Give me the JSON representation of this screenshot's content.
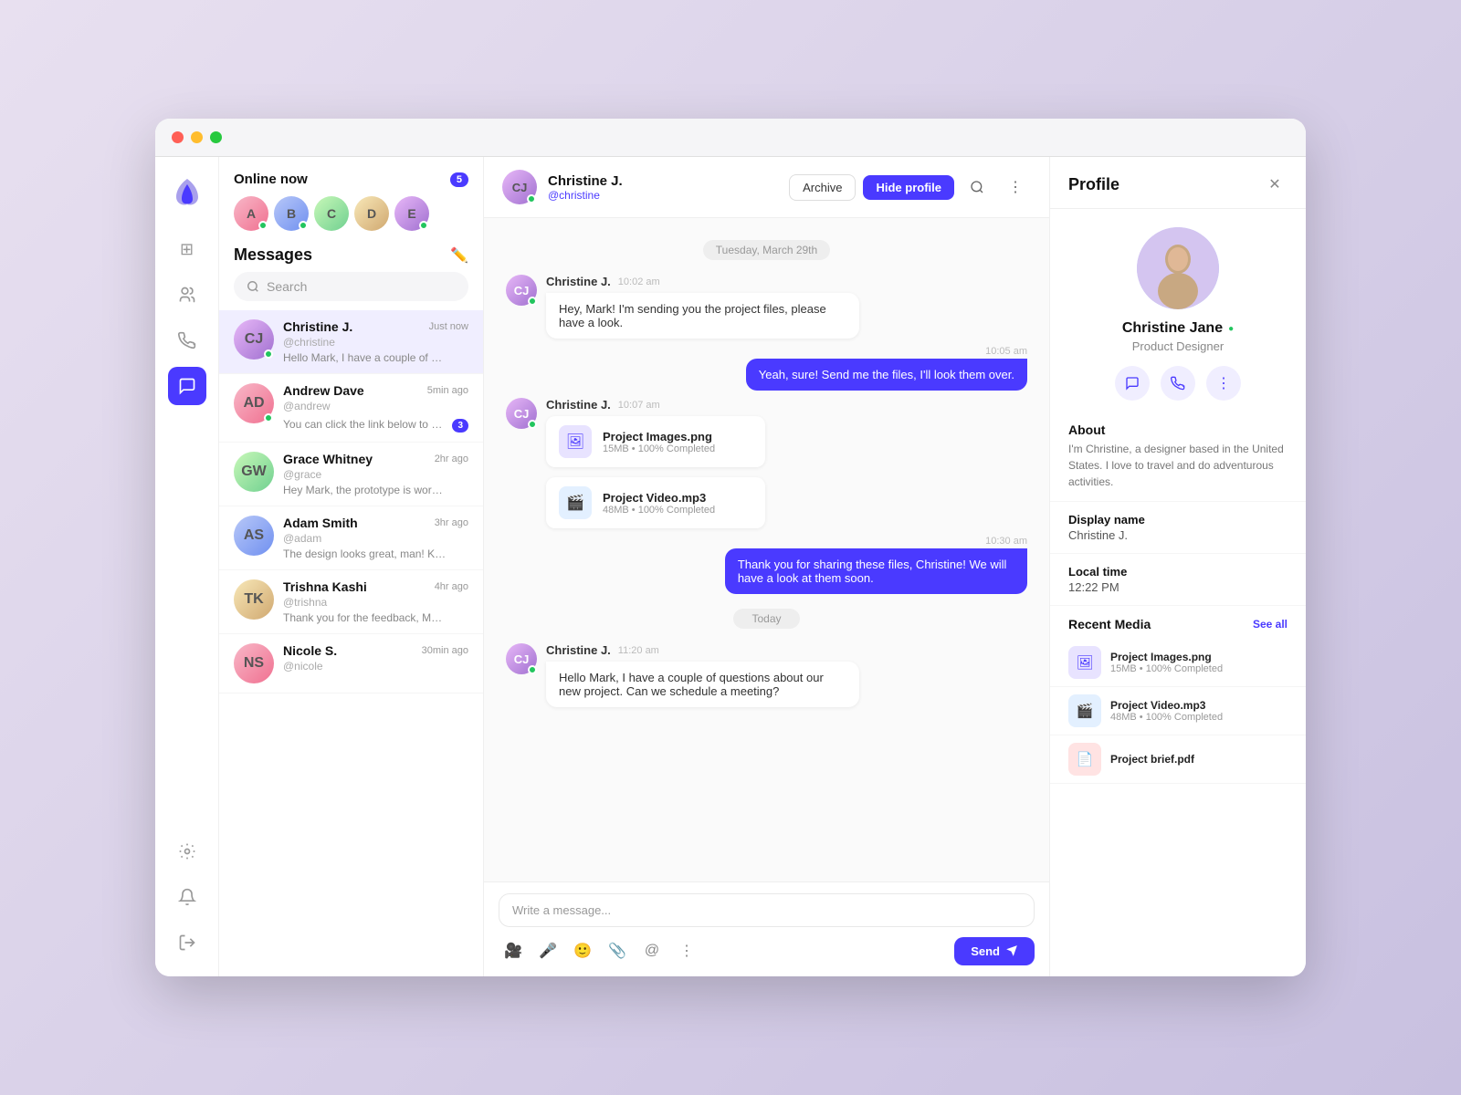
{
  "window": {
    "titlebar": {
      "dot_red": "red",
      "dot_yellow": "yellow",
      "dot_green": "green"
    }
  },
  "nav": {
    "icons": [
      {
        "name": "grid-icon",
        "symbol": "⊞",
        "active": false
      },
      {
        "name": "users-icon",
        "symbol": "👥",
        "active": false
      },
      {
        "name": "phone-icon",
        "symbol": "📞",
        "active": false
      },
      {
        "name": "chat-icon",
        "symbol": "💬",
        "active": true
      },
      {
        "name": "settings-icon",
        "symbol": "⚙",
        "active": false
      },
      {
        "name": "bell-icon",
        "symbol": "🔔",
        "active": false
      },
      {
        "name": "logout-icon",
        "symbol": "⬆",
        "active": false
      }
    ]
  },
  "online": {
    "label": "Online now",
    "count": "5",
    "avatars": [
      {
        "initials": "A",
        "class": "av-c1"
      },
      {
        "initials": "B",
        "class": "av-c2"
      },
      {
        "initials": "C",
        "class": "av-c3"
      },
      {
        "initials": "D",
        "class": "av-c4"
      },
      {
        "initials": "E",
        "class": "av-c5"
      }
    ]
  },
  "messages": {
    "title": "Messages",
    "search_placeholder": "Search",
    "conversations": [
      {
        "name": "Christine J.",
        "handle": "@christine",
        "time": "Just now",
        "preview": "Hello Mark, I have a couple of questions about our new project. Can we schedul...",
        "unread": false,
        "active": true,
        "avatar_class": "av-c5"
      },
      {
        "name": "Andrew Dave",
        "handle": "@andrew",
        "time": "5min ago",
        "preview": "You can click the link below to view the developer handover files, please let me...",
        "unread": true,
        "unread_count": "3",
        "active": false,
        "avatar_class": "av-c1"
      },
      {
        "name": "Grace Whitney",
        "handle": "@grace",
        "time": "2hr ago",
        "preview": "Hey Mark, the prototype is working amazing! Let's move forward 🚀",
        "unread": false,
        "active": false,
        "avatar_class": "av-c3"
      },
      {
        "name": "Adam Smith",
        "handle": "@adam",
        "time": "3hr ago",
        "preview": "The design looks great, man! Keep up the great work! 🔥",
        "unread": false,
        "active": false,
        "avatar_class": "av-c2"
      },
      {
        "name": "Trishna Kashi",
        "handle": "@trishna",
        "time": "4hr ago",
        "preview": "Thank you for the feedback, Mark! I will review your input and make the necess...",
        "unread": false,
        "active": false,
        "avatar_class": "av-c4"
      },
      {
        "name": "Nicole S.",
        "handle": "@nicole",
        "time": "30min ago",
        "preview": "",
        "unread": false,
        "active": false,
        "avatar_class": "av-c1"
      }
    ]
  },
  "chat": {
    "contact_name": "Christine J.",
    "contact_handle": "@christine",
    "archive_label": "Archive",
    "hide_profile_label": "Hide profile",
    "date_divider": "Tuesday, March 29th",
    "today_divider": "Today",
    "messages": [
      {
        "type": "incoming",
        "sender": "Christine J.",
        "time": "10:02 am",
        "text": "Hey, Mark! I'm sending you the project files, please have a look.",
        "is_file": false
      },
      {
        "type": "outgoing",
        "time": "10:05 am",
        "text": "Yeah, sure! Send me the files, I'll look them over.",
        "is_file": false
      },
      {
        "type": "incoming",
        "sender": "Christine J.",
        "time": "10:07 am",
        "is_file": true,
        "files": [
          {
            "name": "Project Images.png",
            "meta": "15MB • 100% Completed",
            "icon": "🖼"
          },
          {
            "name": "Project Video.mp3",
            "meta": "48MB • 100% Completed",
            "icon": "🎬"
          }
        ]
      },
      {
        "type": "outgoing",
        "time": "10:30 am",
        "text": "Thank you for sharing these files, Christine! We will have a look at them soon.",
        "is_file": false
      },
      {
        "type": "incoming",
        "sender": "Christine J.",
        "time": "11:20 am",
        "text": "Hello Mark, I have a couple of questions about our new project. Can we schedule a meeting?",
        "is_file": false
      }
    ],
    "input_placeholder": "Write a message...",
    "send_label": "Send"
  },
  "profile": {
    "title": "Profile",
    "name": "Christine Jane",
    "role": "Product Designer",
    "about_title": "About",
    "about_text": "I'm Christine, a designer based in the United States. I love to travel and do adventurous activities.",
    "display_name_label": "Display name",
    "display_name_value": "Christine J.",
    "local_time_label": "Local time",
    "local_time_value": "12:22 PM",
    "recent_media_title": "Recent Media",
    "see_all_label": "See all",
    "media_files": [
      {
        "name": "Project Images.png",
        "meta": "15MB • 100% Completed",
        "type": "image"
      },
      {
        "name": "Project Video.mp3",
        "meta": "48MB • 100% Completed",
        "type": "video"
      },
      {
        "name": "Project brief.pdf",
        "meta": "",
        "type": "pdf"
      }
    ]
  }
}
